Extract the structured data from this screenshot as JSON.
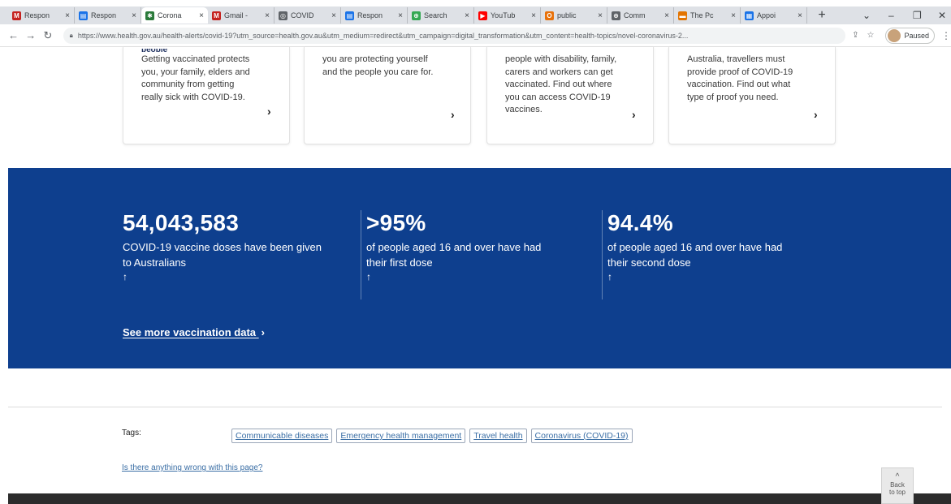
{
  "browser": {
    "tabs": [
      {
        "label": "Respon",
        "icon": "gmail-icon",
        "color": "#c5221f",
        "glyph": "M"
      },
      {
        "label": "Respon",
        "icon": "forms-icon",
        "color": "#1a73e8",
        "glyph": "▤"
      },
      {
        "label": "Corona",
        "icon": "health-crest-icon",
        "color": "#2a7a3a",
        "glyph": "✱",
        "active": true
      },
      {
        "label": "Gmail -",
        "icon": "gmail-icon",
        "color": "#c5221f",
        "glyph": "M"
      },
      {
        "label": "COVID",
        "icon": "globe-icon",
        "color": "#5f6368",
        "glyph": "◎"
      },
      {
        "label": "Respon",
        "icon": "forms-icon",
        "color": "#1a73e8",
        "glyph": "▤"
      },
      {
        "label": "Search",
        "icon": "search-icon",
        "color": "#34a853",
        "glyph": "⊕"
      },
      {
        "label": "YouTub",
        "icon": "youtube-icon",
        "color": "#ff0000",
        "glyph": "▶"
      },
      {
        "label": "public",
        "icon": "public-icon",
        "color": "#e8710a",
        "glyph": "O"
      },
      {
        "label": "Comm",
        "icon": "globe-icon",
        "color": "#5f6368",
        "glyph": "⊕"
      },
      {
        "label": "The Pc",
        "icon": "bookmark-icon",
        "color": "#e37400",
        "glyph": "▬"
      },
      {
        "label": "Appoi",
        "icon": "calendar-icon",
        "color": "#1a73e8",
        "glyph": "▦"
      }
    ],
    "new_tab": "+",
    "controls": {
      "dropdown": "⌄",
      "minimize": "–",
      "restore": "❐",
      "close": "✕"
    },
    "url": "https://www.health.gov.au/health-alerts/covid-19?utm_source=health.gov.au&utm_medium=redirect&utm_campaign=digital_transformation&utm_content=health-topics/novel-coronavirus-2...",
    "profile_label": "Paused"
  },
  "cards": [
    {
      "title": "people",
      "body": "Getting vaccinated protects\nyou, your family, elders and\ncommunity from getting\nreally sick with COVID-19.",
      "chevron": "›"
    },
    {
      "title": "",
      "body": "you are protecting yourself\nand the people you care for.",
      "chevron": "›"
    },
    {
      "title": "",
      "body": "people with disability, family,\ncarers and workers can get\nvaccinated. Find out where\nyou can access COVID-19\nvaccines.",
      "chevron": "›"
    },
    {
      "title": "",
      "body": "Australia, travellers must\nprovide proof of COVID-19\nvaccination. Find out what\ntype of proof you need.",
      "chevron": "›"
    }
  ],
  "stats": [
    {
      "value": "54,043,583",
      "desc": "COVID-19 vaccine doses have been given\nto Australians",
      "arrow": "↑"
    },
    {
      "value": ">95%",
      "desc": "of people aged 16 and over have had\ntheir first dose",
      "arrow": "↑"
    },
    {
      "value": "94.4%",
      "desc": "of people aged 16 and over have had\ntheir second dose",
      "arrow": "↑"
    }
  ],
  "see_more": "See more vaccination data",
  "see_more_chevron": "›",
  "tags_label": "Tags:",
  "tags": [
    "Communicable diseases",
    "Emergency health management",
    "Travel health",
    "Coronavirus (COVID-19)"
  ],
  "wrong_link": "Is there anything wrong with this page?",
  "back_to_top": {
    "line1": "Back",
    "line2": "to top",
    "arrow": "^"
  },
  "colors": {
    "band": "#0e3f8e",
    "link": "#3a6ea5",
    "footer": "#2c2c2c"
  }
}
